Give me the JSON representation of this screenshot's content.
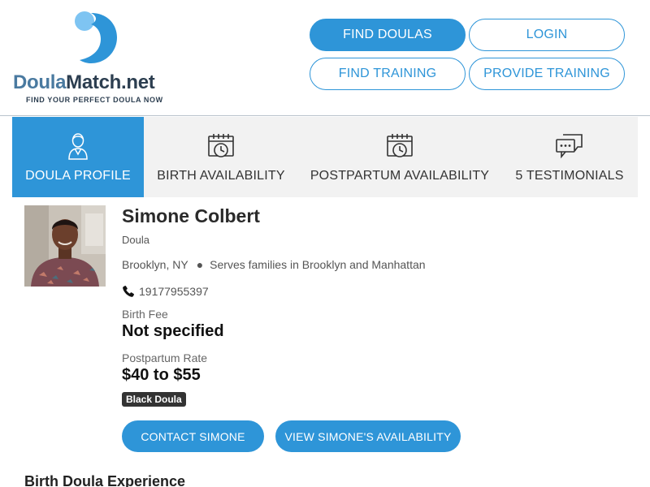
{
  "logo": {
    "word_part1": "Doula",
    "word_part2": "Match.net",
    "tagline": "FIND YOUR PERFECT DOULA NOW",
    "icon": "doulamatch-logo-mark"
  },
  "nav": {
    "find_doulas": "FIND DOULAS",
    "login": "LOGIN",
    "find_training": "FIND TRAINING",
    "provide_training": "PROVIDE TRAINING"
  },
  "tabs": [
    {
      "label": "DOULA PROFILE",
      "icon": "person-icon",
      "active": true
    },
    {
      "label": "BIRTH AVAILABILITY",
      "icon": "calendar-clock-icon",
      "active": false
    },
    {
      "label": "POSTPARTUM AVAILABILITY",
      "icon": "calendar-clock-icon",
      "active": false
    },
    {
      "label": "5 TESTIMONIALS",
      "icon": "chat-bubbles-icon",
      "active": false
    }
  ],
  "profile": {
    "name": "Simone Colbert",
    "role": "Doula",
    "location": "Brooklyn, NY",
    "service_area": "Serves families in Brooklyn and Manhattan",
    "phone": "19177955397",
    "birth_fee_label": "Birth Fee",
    "birth_fee_value": "Not specified",
    "postpartum_label": "Postpartum Rate",
    "postpartum_value": "$40 to $55",
    "badge": "Black Doula",
    "contact_button": "CONTACT SIMONE",
    "availability_button": "VIEW SIMONE'S AVAILABILITY"
  },
  "sections": {
    "experience_title": "Birth Doula Experience"
  },
  "colors": {
    "accent": "#2e95d8",
    "logo_blue": "#4a7aa0",
    "logo_dark": "#2c3e50",
    "tab_bg": "#f2f2f2",
    "badge_bg": "#333333"
  }
}
